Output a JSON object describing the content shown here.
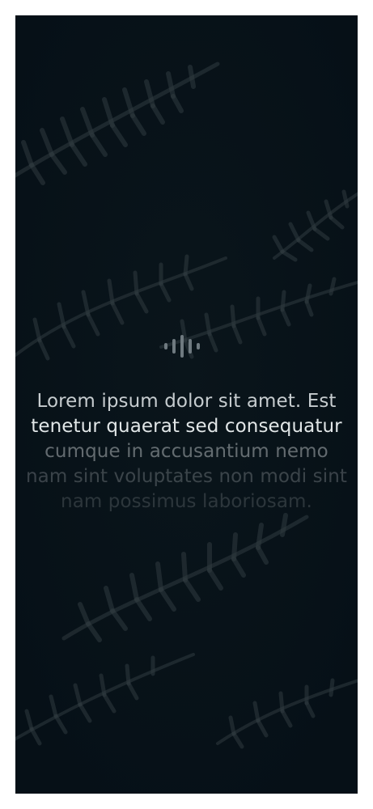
{
  "background": {
    "icon": "fern-leaves",
    "color": "#071017"
  },
  "logo": {
    "icon": "audio-wave-icon",
    "color": "#6f7a80"
  },
  "quote": {
    "lines": [
      "Lorem ipsum dolor sit amet. Est",
      "tenetur quaerat sed consequatur",
      "cumque in accusantium nemo",
      "nam sint voluptates non modi sint",
      "nam possimus laboriosam."
    ]
  }
}
